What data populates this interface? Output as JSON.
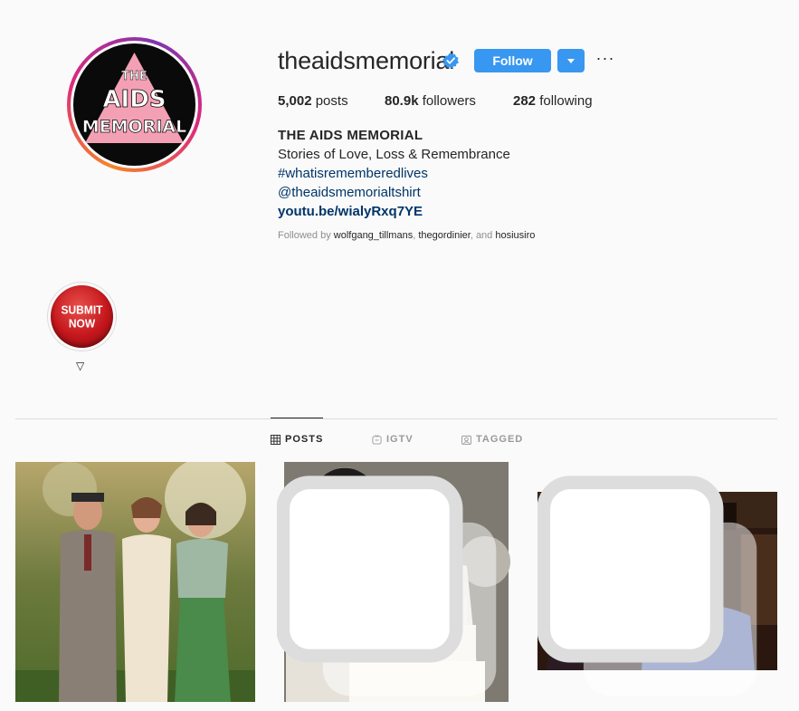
{
  "profile": {
    "username": "theaidsmemorial",
    "avatar_text": [
      "THE",
      "AIDS",
      "MEMORIAL"
    ],
    "verified": true,
    "follow_label": "Follow",
    "more_label": "···",
    "stats": {
      "posts_count": "5,002",
      "posts_label": " posts",
      "followers_count": "80.9k",
      "followers_label": " followers",
      "following_count": "282",
      "following_label": " following"
    },
    "bio": {
      "name": "THE AIDS MEMORIAL",
      "tagline": "Stories of Love, Loss & Remembrance",
      "hashtag": "#whatisrememberedlives",
      "mention": "@theaidsmemorialtshirt",
      "link": "youtu.be/wialyRxq7YE"
    },
    "followed_by": {
      "prefix": "Followed by ",
      "user1": "wolfgang_tillmans",
      "sep1": ", ",
      "user2": "thegordinier",
      "sep2": ", and ",
      "user3": "hosiusiro"
    }
  },
  "highlight": {
    "line1": "SUBMIT",
    "line2": "NOW",
    "label": "▽"
  },
  "tabs": {
    "posts": "POSTS",
    "igtv": "IGTV",
    "tagged": "TAGGED"
  },
  "colors": {
    "accent": "#3897f0",
    "link": "#003569",
    "avatar_triangle": "#f4a0b4"
  },
  "icons": [
    "verified-badge-icon",
    "chevron-down-icon",
    "more-horizontal-icon",
    "grid-icon",
    "igtv-icon",
    "tagged-icon",
    "multiple-photos-icon"
  ]
}
